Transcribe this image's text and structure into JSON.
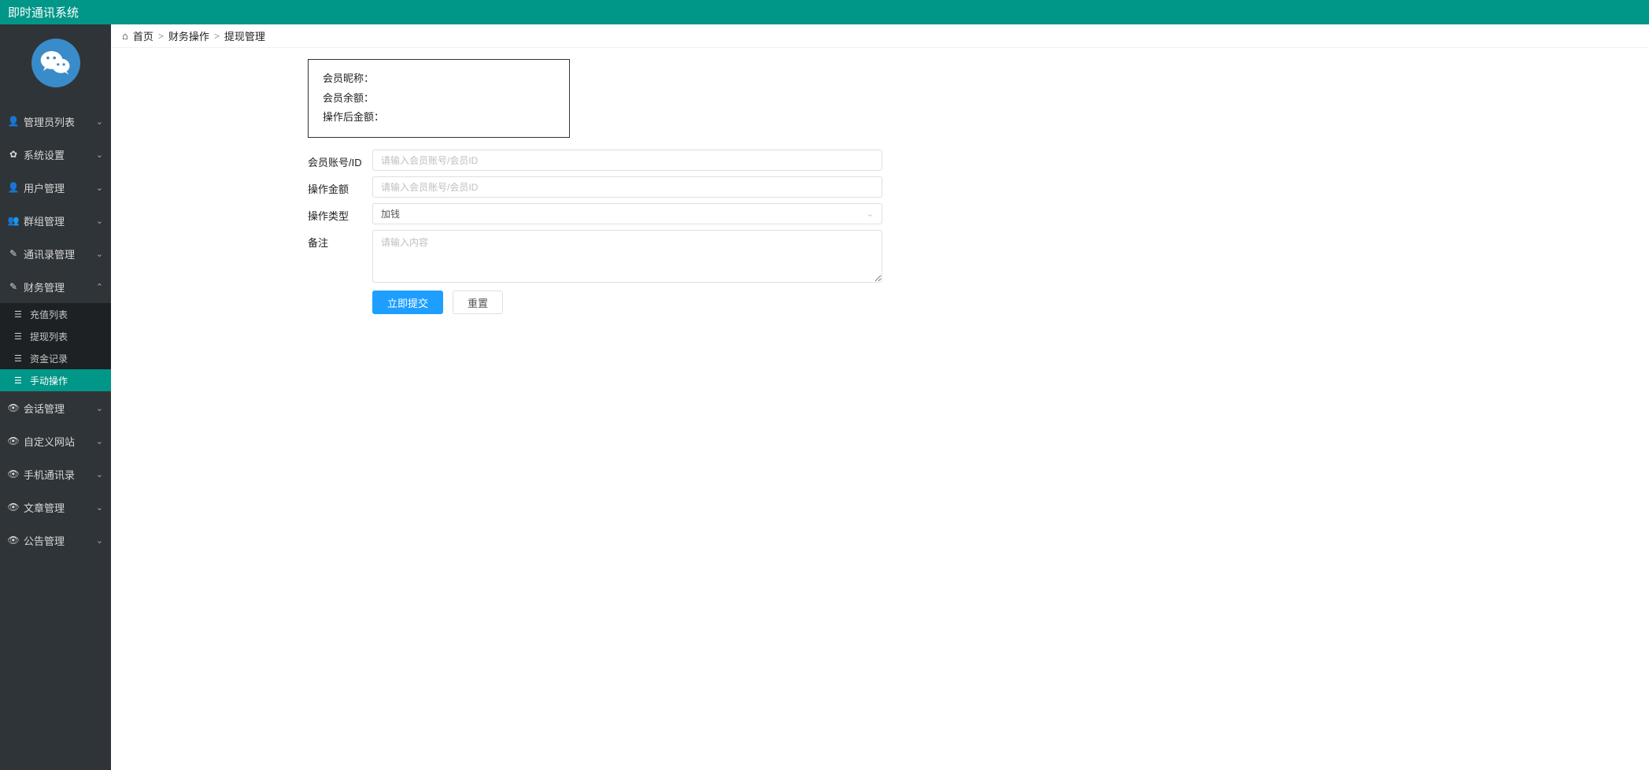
{
  "app_title": "即时通讯系统",
  "breadcrumb": {
    "home": "首页",
    "l1": "财务操作",
    "l2": "提现管理"
  },
  "sidebar": {
    "items": [
      {
        "icon": "user",
        "label": "管理员列表"
      },
      {
        "icon": "cog",
        "label": "系统设置"
      },
      {
        "icon": "user",
        "label": "用户管理"
      },
      {
        "icon": "users",
        "label": "群组管理"
      },
      {
        "icon": "book",
        "label": "通讯录管理"
      },
      {
        "icon": "edit",
        "label": "财务管理",
        "expanded": true,
        "children": [
          {
            "label": "充值列表"
          },
          {
            "label": "提现列表"
          },
          {
            "label": "资金记录"
          },
          {
            "label": "手动操作",
            "active": true
          }
        ]
      },
      {
        "icon": "eye",
        "label": "会话管理"
      },
      {
        "icon": "eye",
        "label": "自定义网站"
      },
      {
        "icon": "eye",
        "label": "手机通讯录"
      },
      {
        "icon": "eye",
        "label": "文章管理"
      },
      {
        "icon": "eye",
        "label": "公告管理"
      }
    ]
  },
  "info": {
    "nickname_label": "会员昵称：",
    "balance_label": "会员余额：",
    "after_label": "操作后金额："
  },
  "form": {
    "account_label": "会员账号/ID",
    "account_placeholder": "请输入会员账号/会员ID",
    "amount_label": "操作金额",
    "amount_placeholder": "请输入会员账号/会员ID",
    "type_label": "操作类型",
    "type_value": "加钱",
    "remark_label": "备注",
    "remark_placeholder": "请输入内容",
    "submit": "立即提交",
    "reset": "重置"
  }
}
